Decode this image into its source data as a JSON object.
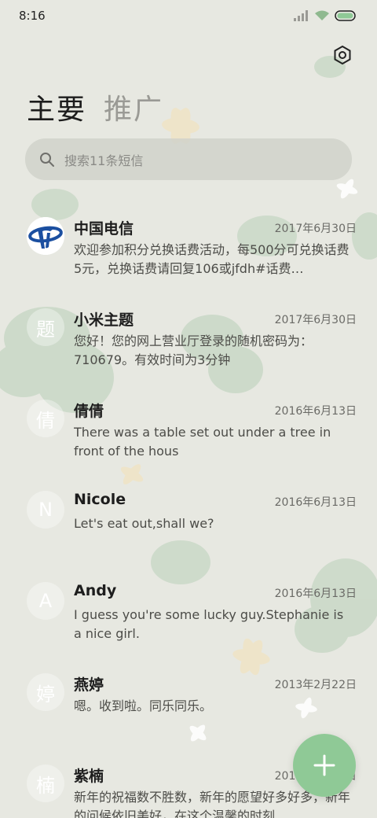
{
  "status_bar": {
    "time": "8:16"
  },
  "tabs": [
    {
      "label": "主要",
      "active": true
    },
    {
      "label": "推广",
      "active": false
    }
  ],
  "search": {
    "placeholder": "搜索11条短信"
  },
  "conversations": [
    {
      "name": "中国电信",
      "date": "2017年6月30日",
      "snippet": "欢迎参加积分兑换话费活动，每500分可兑换话费5元，兑换话费请回复106或jfdh#话费…",
      "avatar_text": "",
      "avatar_icon": "china-telecom-logo"
    },
    {
      "name": "小米主题",
      "date": "2017年6月30日",
      "snippet": "您好！您的网上营业厅登录的随机密码为：710679。有效时间为3分钟",
      "avatar_text": "题"
    },
    {
      "name": "倩倩",
      "date": "2016年6月13日",
      "snippet": "There was a table set out under a tree in front of the hous",
      "avatar_text": "倩"
    },
    {
      "name": "Nicole",
      "date": "2016年6月13日",
      "snippet": "Let's eat out,shall we?",
      "avatar_text": "N"
    },
    {
      "name": "Andy",
      "date": "2016年6月13日",
      "snippet": "I guess you're some lucky guy.Stephanie is a nice girl.",
      "avatar_text": "A"
    },
    {
      "name": "燕婷",
      "date": "2013年2月22日",
      "snippet": "嗯。收到啦。同乐同乐。",
      "avatar_text": "婷"
    },
    {
      "name": "紫楠",
      "date": "2013年2月22日",
      "snippet": "新年的祝福数不胜数，新年的愿望好多好多，新年的问候依旧美好，在这个温馨的时刻",
      "avatar_text": "楠"
    }
  ],
  "colors": {
    "background": "#e7e8e1",
    "accent": "#8fc996",
    "telecom_blue": "#1b4fa0"
  }
}
